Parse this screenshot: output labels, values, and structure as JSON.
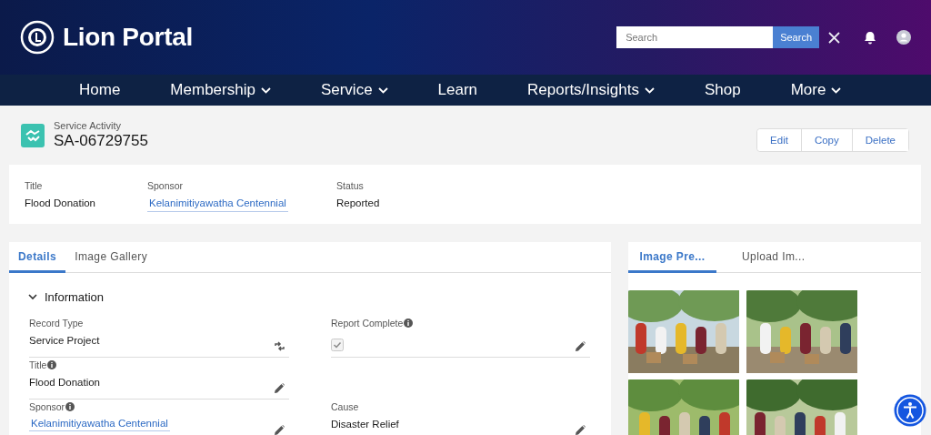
{
  "header": {
    "title": "Lion Portal",
    "search": {
      "placeholder": "Search"
    },
    "search_button": "Search"
  },
  "nav": [
    {
      "label": "Home",
      "menu": false
    },
    {
      "label": "Membership",
      "menu": true
    },
    {
      "label": "Service",
      "menu": true
    },
    {
      "label": "Learn",
      "menu": false
    },
    {
      "label": "Reports/Insights",
      "menu": true
    },
    {
      "label": "Shop",
      "menu": false
    },
    {
      "label": "More",
      "menu": true
    }
  ],
  "record": {
    "type": "Service Activity",
    "name": "SA-06729755"
  },
  "actions": [
    "Edit",
    "Copy",
    "Delete"
  ],
  "highlights": [
    {
      "label": "Title",
      "value": "Flood Donation",
      "kind": "text"
    },
    {
      "label": "Sponsor",
      "value": "Kelanimitiyawatha Centennial",
      "kind": "link"
    },
    {
      "label": "Status",
      "value": "Reported",
      "kind": "text"
    }
  ],
  "detail_tabs": [
    {
      "label": "Details",
      "selected": true
    },
    {
      "label": "Image Gallery",
      "selected": false
    }
  ],
  "section": {
    "title": "Information",
    "expanded": true
  },
  "fields": [
    {
      "label": "Record Type",
      "info": false,
      "kind": "text",
      "value": "Service Project",
      "editable": false,
      "type_switch": true
    },
    {
      "label": "Report Complete",
      "info": true,
      "kind": "checkbox",
      "checked": true,
      "editable": true,
      "type_switch": false
    },
    {
      "label": "Title",
      "info": true,
      "kind": "text",
      "value": "Flood Donation",
      "editable": true,
      "type_switch": false
    },
    {
      "kind": "blank"
    },
    {
      "label": "Sponsor",
      "info": true,
      "kind": "link",
      "value": "Kelanimitiyawatha Centennial",
      "editable": true,
      "type_switch": false
    },
    {
      "label": "Cause",
      "info": false,
      "kind": "text",
      "value": "Disaster Relief",
      "editable": true,
      "type_switch": false
    }
  ],
  "gallery_tabs": [
    {
      "label": "Image Pre...",
      "selected": true
    },
    {
      "label": "Upload Im...",
      "selected": false
    }
  ],
  "images": [
    {
      "kind": "picture"
    },
    {
      "kind": "picture"
    },
    {
      "kind": "picture"
    },
    {
      "kind": "picture"
    }
  ]
}
